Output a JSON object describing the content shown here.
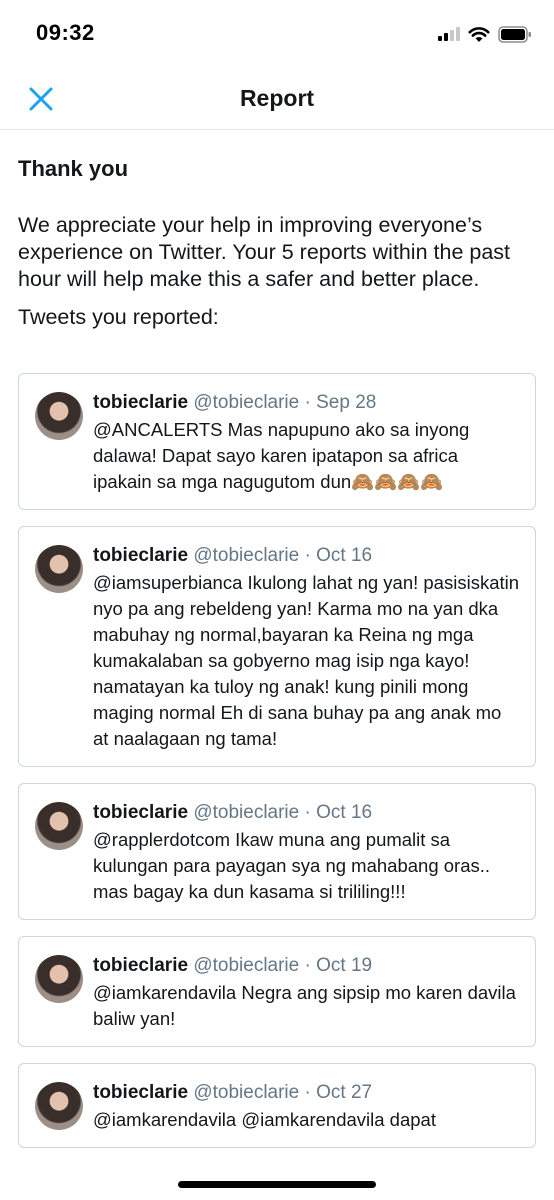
{
  "status_bar": {
    "time": "09:32"
  },
  "nav": {
    "title": "Report"
  },
  "main": {
    "heading": "Thank you",
    "message": "We appreciate your help in improving everyone’s experience on Twitter. Your 5 reports within the past hour will help make this a safer and better place.",
    "tweets_label": "Tweets you reported:"
  },
  "tweets": [
    {
      "name": "tobieclarie",
      "handle": "@tobieclarie",
      "sep": "·",
      "date": "Sep 28",
      "text": "@ANCALERTS Mas napupuno ako sa inyong dalawa! Dapat sayo karen ipatapon sa africa ipakain sa mga nagugutom dun🙈🙈🙈🙈"
    },
    {
      "name": "tobieclarie",
      "handle": "@tobieclarie",
      "sep": "·",
      "date": "Oct 16",
      "text": "@iamsuperbianca Ikulong lahat ng yan! pasisiskatin nyo pa ang rebeldeng yan! Karma mo na yan dka mabuhay ng normal,bayaran ka Reina ng mga kumakalaban sa gobyerno mag isip nga kayo! namatayan ka tuloy ng anak! kung pinili mong maging normal  Eh di sana buhay pa ang anak mo at naalagaan ng tama!"
    },
    {
      "name": "tobieclarie",
      "handle": "@tobieclarie",
      "sep": "·",
      "date": "Oct 16",
      "text": "@rapplerdotcom Ikaw muna ang pumalit sa kulungan para payagan sya ng mahabang oras.. mas bagay ka dun kasama si trililing!!!"
    },
    {
      "name": "tobieclarie",
      "handle": "@tobieclarie",
      "sep": "·",
      "date": "Oct 19",
      "text": "@iamkarendavila Negra ang sipsip mo karen davila baliw yan!"
    },
    {
      "name": "tobieclarie",
      "handle": "@tobieclarie",
      "sep": "·",
      "date": "Oct 27",
      "text": "@iamkarendavila @iamkarendavila  dapat"
    }
  ],
  "colors": {
    "accent": "#1da1f2",
    "text": "#14171a",
    "secondary_text": "#657786",
    "border": "#ccd6dd"
  },
  "icons": {
    "close": "close-icon",
    "signal": "cellular-signal-icon",
    "wifi": "wifi-icon",
    "battery": "battery-icon"
  }
}
